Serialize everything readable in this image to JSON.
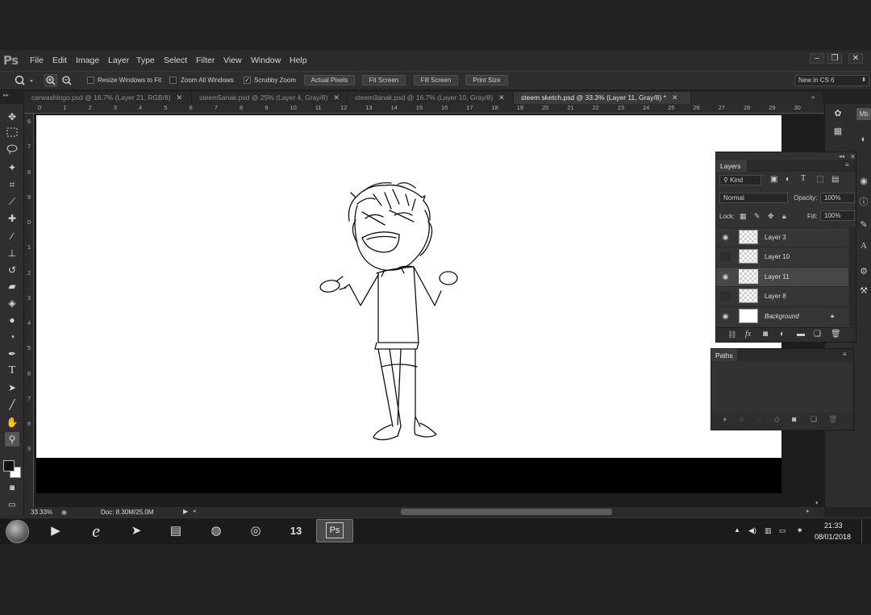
{
  "app": {
    "logo": "Ps"
  },
  "menu": [
    "File",
    "Edit",
    "Image",
    "Layer",
    "Type",
    "Select",
    "Filter",
    "View",
    "Window",
    "Help"
  ],
  "window_controls": [
    "–",
    "❐",
    "✕"
  ],
  "options_bar": {
    "checks": [
      {
        "label": "Resize Windows to Fit",
        "checked": false
      },
      {
        "label": "Zoom All Windows",
        "checked": false
      },
      {
        "label": "Scrubby Zoom",
        "checked": true
      }
    ],
    "buttons": [
      "Actual Pixels",
      "Fit Screen",
      "Fill Screen",
      "Print Size"
    ],
    "workspace": "New in CS 6"
  },
  "tabs": [
    {
      "label": "carwashlogo.psd @ 16.7% (Layer 21, RGB/8)",
      "active": false
    },
    {
      "label": "steem5anak.psd @ 25% (Layer 4, Gray/8)",
      "active": false
    },
    {
      "label": "steem3anak.psd @ 16.7% (Layer 10, Gray/8)",
      "active": false
    },
    {
      "label": "steem sketch.psd @ 33.3% (Layer 11, Gray/8) *",
      "active": true
    }
  ],
  "ruler_h": [
    "0",
    "1",
    "2",
    "3",
    "4",
    "5",
    "6",
    "7",
    "8",
    "9",
    "10",
    "11",
    "12",
    "13",
    "14",
    "15",
    "16",
    "17",
    "18",
    "19",
    "20",
    "21",
    "22",
    "23",
    "24",
    "25",
    "26",
    "27",
    "28",
    "29",
    "30"
  ],
  "ruler_v": [
    "6",
    "7",
    "8",
    "9",
    "0",
    "1",
    "2",
    "3",
    "4",
    "5",
    "6",
    "7",
    "8",
    "9"
  ],
  "layers_panel": {
    "title": "Layers",
    "kind": "Kind",
    "blend_mode": "Normal",
    "opacity_label": "Opacity:",
    "opacity": "100%",
    "lock_label": "Lock:",
    "fill_label": "Fill:",
    "fill": "100%",
    "layers": [
      {
        "name": "Layer 3",
        "visible": true,
        "selected": false,
        "thumb": "transparent"
      },
      {
        "name": "Layer 10",
        "visible": false,
        "selected": false,
        "thumb": "transparent"
      },
      {
        "name": "Layer 11",
        "visible": true,
        "selected": true,
        "thumb": "transparent"
      },
      {
        "name": "Layer 8",
        "visible": false,
        "selected": false,
        "thumb": "transparent"
      },
      {
        "name": "Background",
        "visible": true,
        "selected": false,
        "thumb": "white",
        "locked": true
      }
    ]
  },
  "paths_panel": {
    "title": "Paths"
  },
  "status": {
    "zoom": "33.33%",
    "doc": "Doc: 8.30M/25.0M"
  },
  "taskbar": {
    "time": "21:33",
    "date": "08/01/2018",
    "active_app": "Ps"
  }
}
